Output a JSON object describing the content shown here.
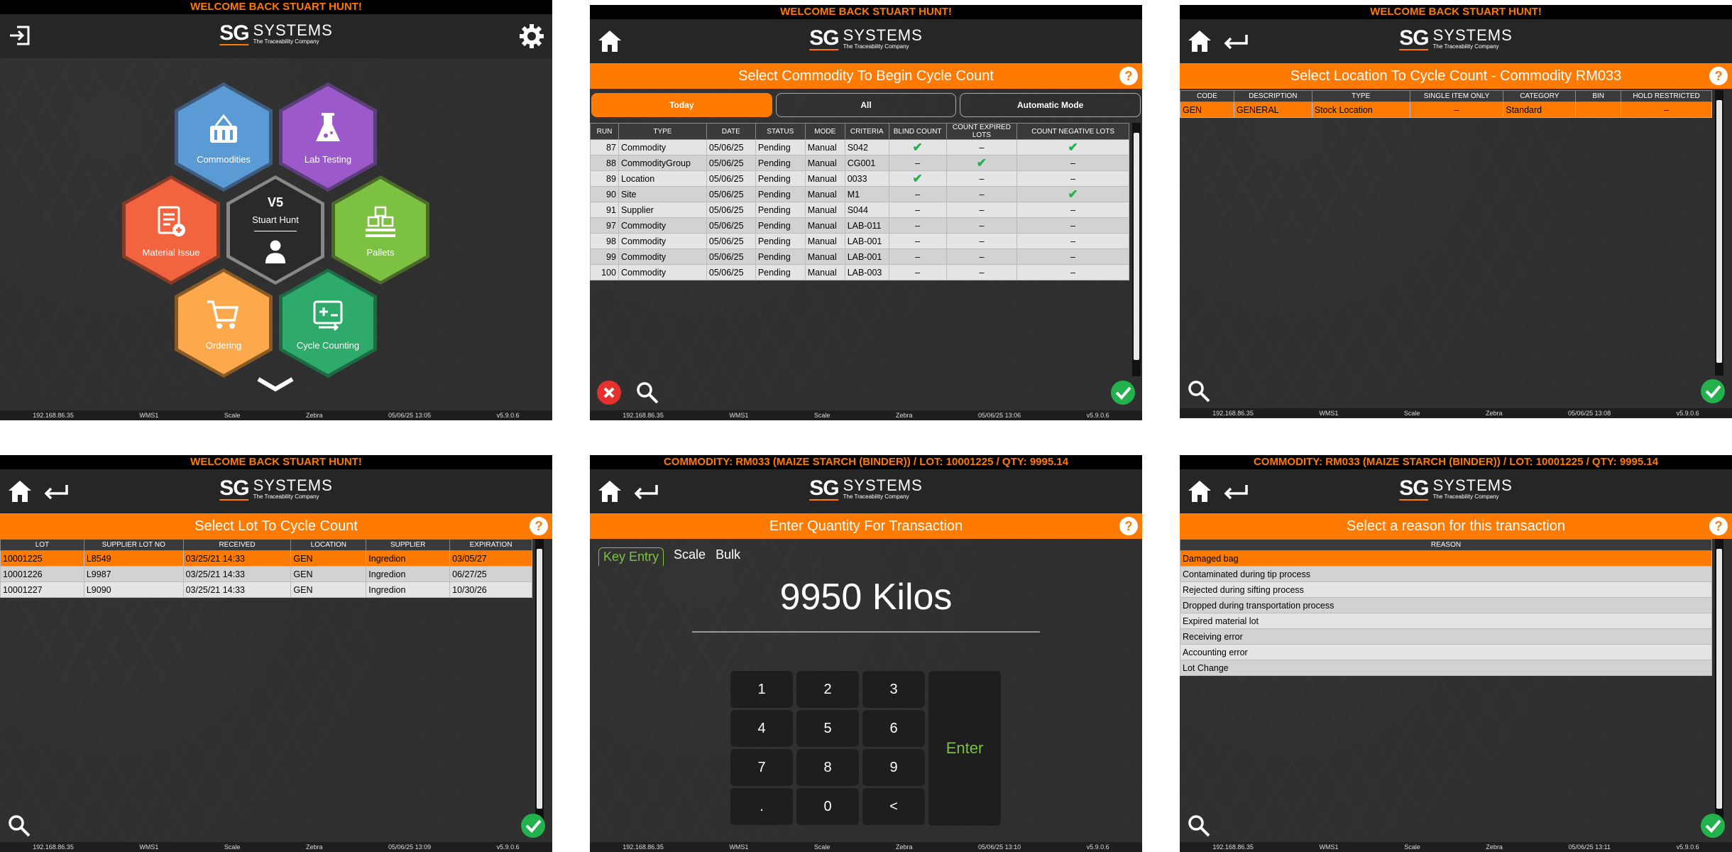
{
  "colors": {
    "accent": "#ff7a00",
    "ok": "#22b14c",
    "cancel": "#e53030",
    "lime": "#7dc142"
  },
  "logo": {
    "sg": "SG",
    "systems": "SYSTEMS",
    "tagline": "The Traceability Company"
  },
  "screen1": {
    "welcome": "WELCOME BACK STUART HUNT!",
    "tiles": {
      "commodities": "Commodities",
      "lab": "Lab Testing",
      "material": "Material Issue",
      "center_brand": "V5",
      "user": "Stuart Hunt",
      "pallets": "Pallets",
      "ordering": "Ordering",
      "cycle": "Cycle Counting"
    },
    "footer": [
      "192.168.86.35",
      "WMS1",
      "Scale",
      "Zebra",
      "05/06/25 13:05",
      "v5.9.0.6"
    ]
  },
  "screen2": {
    "welcome": "WELCOME BACK STUART HUNT!",
    "title": "Select Commodity To Begin Cycle Count",
    "help": "?",
    "tabs": [
      "Today",
      "All",
      "Automatic Mode"
    ],
    "columns": [
      "RUN",
      "TYPE",
      "DATE",
      "STATUS",
      "MODE",
      "CRITERIA",
      "BLIND COUNT",
      "COUNT EXPIRED LOTS",
      "COUNT NEGATIVE LOTS"
    ],
    "rows": [
      [
        "87",
        "Commodity",
        "05/06/25",
        "Pending",
        "Manual",
        "S042",
        "check",
        "dash",
        "check"
      ],
      [
        "88",
        "CommodityGroup",
        "05/06/25",
        "Pending",
        "Manual",
        "CG001",
        "dash",
        "check",
        "dash"
      ],
      [
        "89",
        "Location",
        "05/06/25",
        "Pending",
        "Manual",
        "0033",
        "check",
        "dash",
        "dash"
      ],
      [
        "90",
        "Site",
        "05/06/25",
        "Pending",
        "Manual",
        "M1",
        "dash",
        "dash",
        "check"
      ],
      [
        "91",
        "Supplier",
        "05/06/25",
        "Pending",
        "Manual",
        "S044",
        "dash",
        "dash",
        "dash"
      ],
      [
        "97",
        "Commodity",
        "05/06/25",
        "Pending",
        "Manual",
        "LAB-011",
        "dash",
        "dash",
        "dash"
      ],
      [
        "98",
        "Commodity",
        "05/06/25",
        "Pending",
        "Manual",
        "LAB-001",
        "dash",
        "dash",
        "dash"
      ],
      [
        "99",
        "Commodity",
        "05/06/25",
        "Pending",
        "Manual",
        "LAB-001",
        "dash",
        "dash",
        "dash"
      ],
      [
        "100",
        "Commodity",
        "05/06/25",
        "Pending",
        "Manual",
        "LAB-003",
        "dash",
        "dash",
        "dash"
      ]
    ],
    "footer": [
      "192.168.86.35",
      "WMS1",
      "Scale",
      "Zebra",
      "05/06/25 13:06",
      "v5.9.0.6"
    ]
  },
  "screen3": {
    "welcome": "WELCOME BACK STUART HUNT!",
    "title": "Select Location To Cycle Count - Commodity RM033",
    "help": "?",
    "columns": [
      "CODE",
      "DESCRIPTION",
      "TYPE",
      "SINGLE ITEM ONLY",
      "CATEGORY",
      "BIN",
      "HOLD RESTRICTED"
    ],
    "rows": [
      [
        "GEN",
        "GENERAL",
        "Stock Location",
        "–",
        "Standard",
        "",
        "–"
      ]
    ],
    "footer": [
      "192.168.86.35",
      "WMS1",
      "Scale",
      "Zebra",
      "05/06/25 13:08",
      "v5.9.0.6"
    ]
  },
  "screen4": {
    "welcome": "WELCOME BACK STUART HUNT!",
    "title": "Select Lot To Cycle Count",
    "help": "?",
    "columns": [
      "LOT",
      "SUPPLIER LOT NO",
      "RECEIVED",
      "LOCATION",
      "SUPPLIER",
      "EXPIRATION"
    ],
    "rows": [
      [
        "10001225",
        "L8549",
        "03/25/21 14:33",
        "GEN",
        "Ingredion",
        "03/05/27"
      ],
      [
        "10001226",
        "L9987",
        "03/25/21 14:33",
        "GEN",
        "Ingredion",
        "06/27/25"
      ],
      [
        "10001227",
        "L9090",
        "03/25/21 14:33",
        "GEN",
        "Ingredion",
        "10/30/26"
      ]
    ],
    "footer": [
      "192.168.86.35",
      "WMS1",
      "Scale",
      "Zebra",
      "05/06/25 13:09",
      "v5.9.0.6"
    ]
  },
  "screen5": {
    "welcome": "COMMODITY: RM033 (MAIZE STARCH (BINDER)) / LOT: 10001225 / QTY: 9995.14",
    "title": "Enter Quantity For Transaction",
    "help": "?",
    "tabs": [
      "Key Entry",
      "Scale",
      "Bulk"
    ],
    "quantity": "9950 Kilos",
    "keys": [
      "1",
      "2",
      "3",
      "4",
      "5",
      "6",
      "7",
      "8",
      "9",
      ".",
      "0",
      "<"
    ],
    "enter": "Enter",
    "footer": [
      "192.168.86.35",
      "WMS1",
      "Scale",
      "Zebra",
      "05/06/25 13:10",
      "v5.9.0.6"
    ]
  },
  "screen6": {
    "welcome": "COMMODITY: RM033 (MAIZE STARCH (BINDER)) / LOT: 10001225 / QTY: 9995.14",
    "title": "Select a reason for this transaction",
    "help": "?",
    "column": "REASON",
    "rows": [
      "Damaged bag",
      "Contaminated during tip process",
      "Rejected during sifting process",
      "Dropped during transportation process",
      "Expired material lot",
      "Receiving error",
      "Accounting error",
      "Lot Change"
    ],
    "footer": [
      "192.168.86.35",
      "WMS1",
      "Scale",
      "Zebra",
      "05/06/25 13:11",
      "v5.9.0.6"
    ]
  }
}
